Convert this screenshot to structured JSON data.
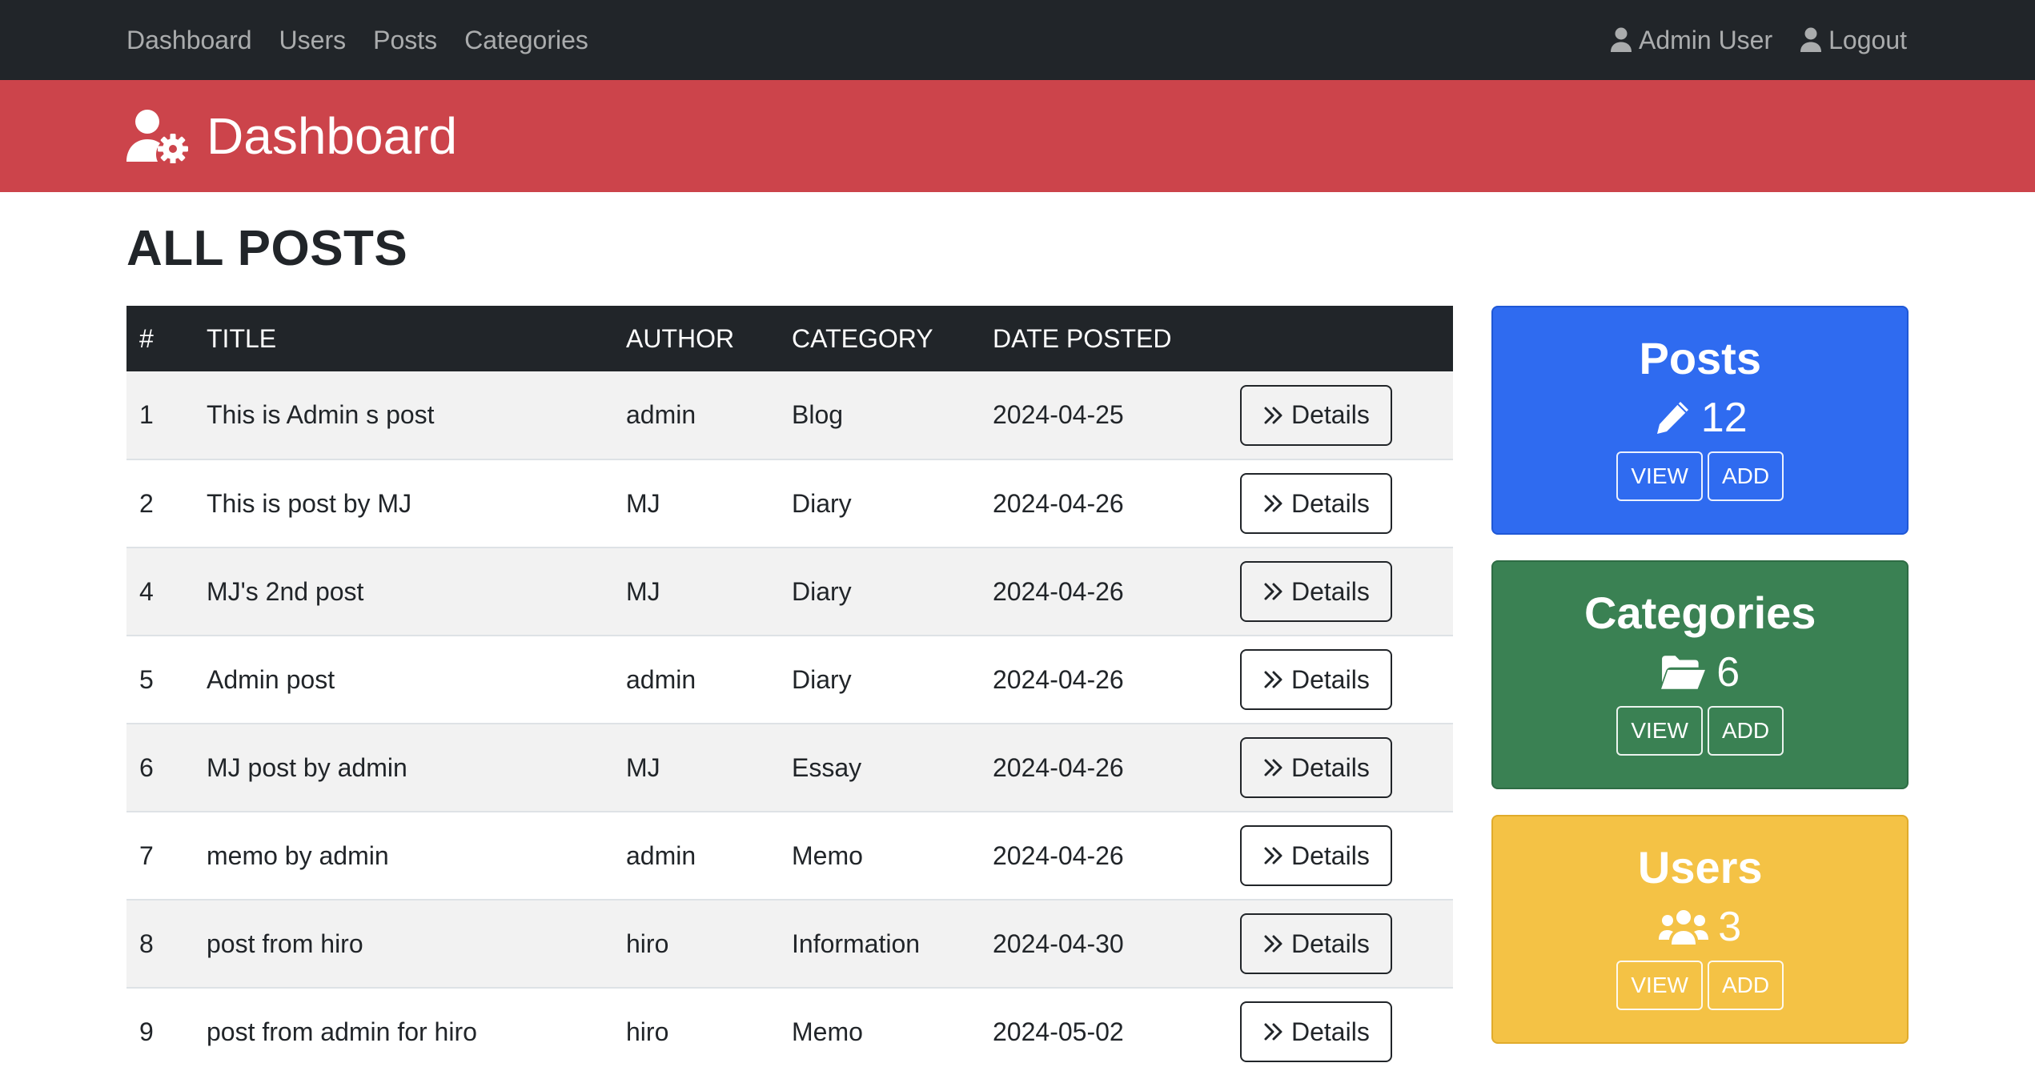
{
  "nav": {
    "links": [
      "Dashboard",
      "Users",
      "Posts",
      "Categories"
    ],
    "user": "Admin User",
    "logout": "Logout"
  },
  "header": {
    "title": "Dashboard"
  },
  "main": {
    "section_title": "ALL POSTS"
  },
  "table": {
    "headers": [
      "#",
      "TITLE",
      "AUTHOR",
      "CATEGORY",
      "DATE POSTED"
    ],
    "details_label": "Details",
    "rows": [
      [
        "1",
        "This is Admin s post",
        "admin",
        "Blog",
        "2024-04-25"
      ],
      [
        "2",
        "This is post by MJ",
        "MJ",
        "Diary",
        "2024-04-26"
      ],
      [
        "4",
        "MJ's 2nd post",
        "MJ",
        "Diary",
        "2024-04-26"
      ],
      [
        "5",
        "Admin post",
        "admin",
        "Diary",
        "2024-04-26"
      ],
      [
        "6",
        "MJ post by admin",
        "MJ",
        "Essay",
        "2024-04-26"
      ],
      [
        "7",
        "memo by admin",
        "admin",
        "Memo",
        "2024-04-26"
      ],
      [
        "8",
        "post from hiro",
        "hiro",
        "Information",
        "2024-04-30"
      ],
      [
        "9",
        "post from admin for hiro",
        "hiro",
        "Memo",
        "2024-05-02"
      ]
    ]
  },
  "cards": {
    "posts": {
      "title": "Posts",
      "count": "12",
      "view": "VIEW",
      "add": "ADD",
      "icon": "pencil-icon",
      "color": "#2f6bf0"
    },
    "categories": {
      "title": "Categories",
      "count": "6",
      "view": "VIEW",
      "add": "ADD",
      "icon": "folder-open-icon",
      "color": "#3a8153"
    },
    "users": {
      "title": "Users",
      "count": "3",
      "view": "VIEW",
      "add": "ADD",
      "icon": "users-icon",
      "color": "#f4c245"
    }
  },
  "colors": {
    "navbar": "#212529",
    "header": "#cc444b"
  }
}
